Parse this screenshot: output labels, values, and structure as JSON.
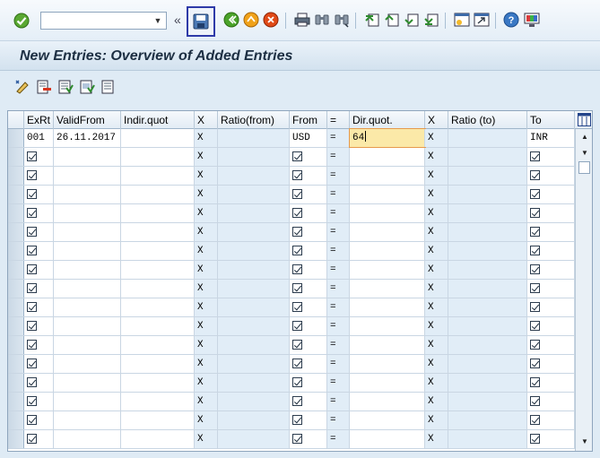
{
  "toolbar": {
    "command_placeholder": "",
    "icons": [
      "enter-icon",
      "back-icon",
      "save-icon",
      "back-arrow-icon",
      "exit-icon",
      "cancel-icon",
      "print-icon",
      "find-icon",
      "find-next-icon",
      "first-page-icon",
      "prev-page-icon",
      "next-page-icon",
      "last-page-icon",
      "create-session-icon",
      "shortcut-icon",
      "help-icon",
      "customize-layout-icon"
    ]
  },
  "title": "New Entries: Overview of Added Entries",
  "app_toolbar": {
    "icons": [
      "change-display-icon",
      "delete-icon",
      "select-all-icon",
      "select-block-icon",
      "deselect-all-icon"
    ]
  },
  "table": {
    "columns": [
      "ExRt",
      "ValidFrom",
      "Indir.quot",
      "X",
      "Ratio(from)",
      "From",
      "=",
      "Dir.quot.",
      "X",
      "Ratio (to)",
      "To"
    ],
    "first_row": {
      "exrt": "001",
      "valid_from": "26.11.2017",
      "indir_quot": "",
      "x1": "X",
      "ratio_from": "",
      "from": "USD",
      "eq": "=",
      "dir_quot": "64",
      "x2": "X",
      "ratio_to": "",
      "to": "INR"
    },
    "empty_row": {
      "x": "X",
      "eq": "="
    }
  },
  "colors": {
    "background": "#dfebf5",
    "readonly_cell": "#e1edf7",
    "active_cell": "#fbe9a8",
    "save_highlight": "#2e3aa8"
  }
}
